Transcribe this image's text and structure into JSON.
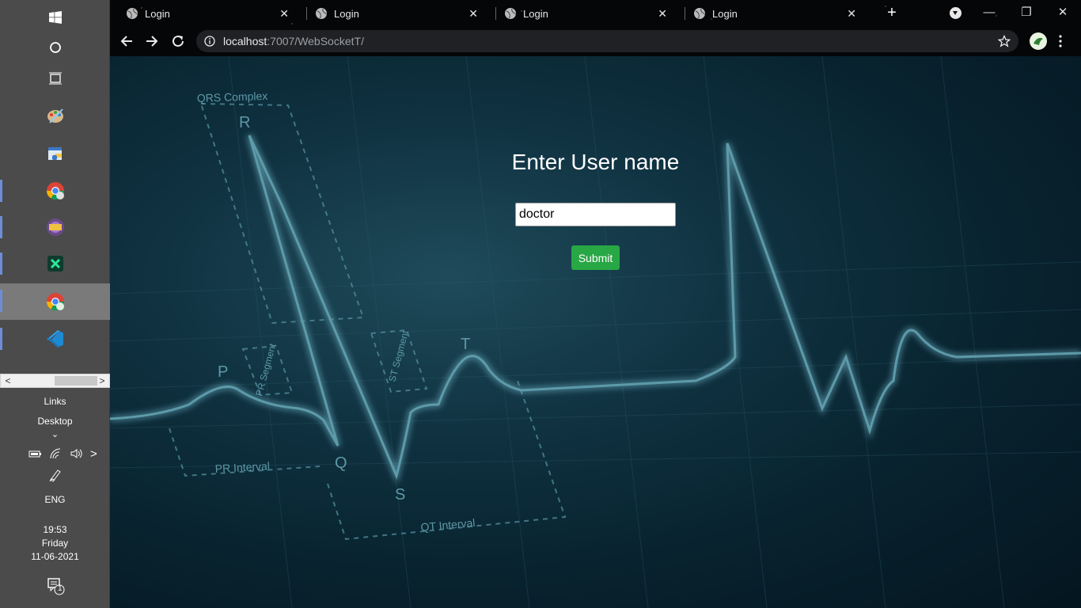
{
  "taskbar": {
    "scroll_left": "<",
    "scroll_right": ">",
    "links_label": "Links",
    "desktop_label": "Desktop",
    "desktop_chevron": "⌄",
    "tray_chevron": ">",
    "language": "ENG",
    "clock": {
      "time": "19:53",
      "day": "Friday",
      "date": "11-06-2021"
    },
    "notification_count": "1",
    "accent": "#6d8ed6"
  },
  "browser": {
    "tabs": [
      {
        "title": "Login",
        "close": "✕"
      },
      {
        "title": "Login",
        "close": "✕"
      },
      {
        "title": "Login",
        "close": "✕"
      },
      {
        "title": "Login",
        "close": "✕"
      }
    ],
    "new_tab": "+",
    "window_controls": {
      "minimize": "—",
      "restore": "❐",
      "close": "✕"
    },
    "address": {
      "host": "localhost",
      "rest": ":7007/WebSocketT/"
    }
  },
  "page": {
    "title": "Enter User name",
    "username_value": "doctor",
    "submit_label": "Submit",
    "submit_color": "#28a745"
  },
  "background_labels": {
    "qrs": "QRS Complex",
    "r": "R",
    "p": "P",
    "q": "Q",
    "s": "S",
    "t": "T",
    "pr_segment": "PR Segment",
    "st_segment": "ST Segment",
    "pr_interval": "PR Interval",
    "qt_interval": "QT Interval"
  }
}
